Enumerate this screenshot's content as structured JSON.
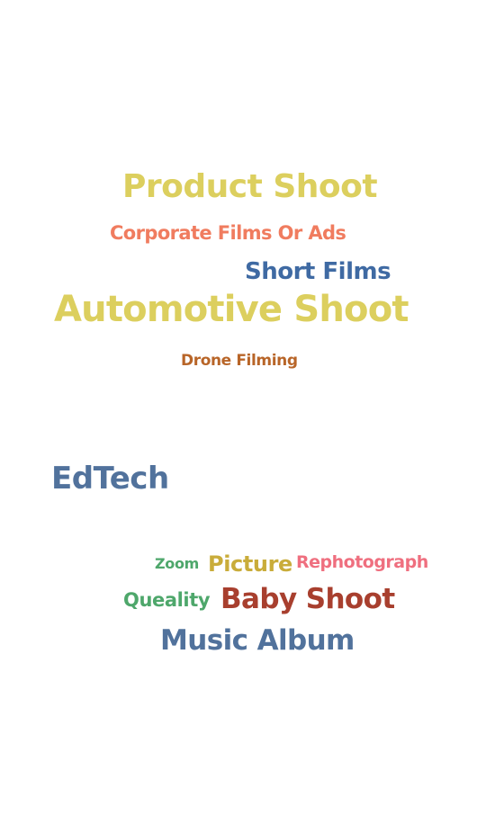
{
  "word_cloud": {
    "words": [
      {
        "text": "Product Shoot",
        "color": "#dccf5e"
      },
      {
        "text": "Corporate Films Or Ads",
        "color": "#f07c5f"
      },
      {
        "text": "Short Films",
        "color": "#3f6aa3"
      },
      {
        "text": "Automotive Shoot",
        "color": "#dccf5e"
      },
      {
        "text": "Drone Filming",
        "color": "#b86528"
      },
      {
        "text": "EdTech",
        "color": "#51729c"
      },
      {
        "text": "Zoom",
        "color": "#4ea76b"
      },
      {
        "text": "Picture",
        "color": "#c9ac3a"
      },
      {
        "text": "Rephotograph",
        "color": "#ef6f7f"
      },
      {
        "text": "Queality",
        "color": "#4ea76b"
      },
      {
        "text": "Baby Shoot",
        "color": "#a83f2e"
      },
      {
        "text": "Music Album",
        "color": "#51729c"
      }
    ]
  }
}
